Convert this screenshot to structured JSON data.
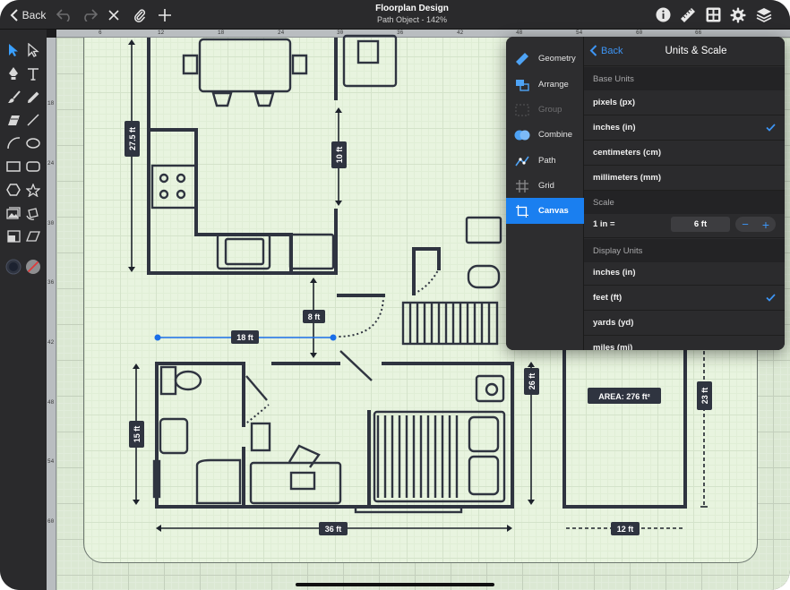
{
  "toolbar": {
    "back_label": "Back",
    "title": "Floorplan Design",
    "subtitle": "Path Object - 142%",
    "icons": [
      "undo-icon",
      "redo-icon",
      "close-icon",
      "paperclip-icon",
      "plus-icon",
      "info-icon",
      "ruler-icon",
      "grid-icon",
      "gear-icon",
      "layers-icon"
    ]
  },
  "tools": [
    "select-arrow",
    "direct-select",
    "pen",
    "text",
    "brush",
    "pencil",
    "eraser",
    "line",
    "arc",
    "ellipse",
    "rectangle",
    "rounded-rectangle",
    "hexagon",
    "star",
    "image",
    "rotate",
    "crop",
    "skew",
    "fill-color",
    "stroke-none"
  ],
  "ruler": {
    "top_labels": [
      "6",
      "12",
      "18",
      "24",
      "30",
      "36",
      "42",
      "48",
      "54",
      "60",
      "66"
    ],
    "left_labels": [
      "18",
      "24",
      "30",
      "36",
      "42",
      "48",
      "54",
      "60"
    ]
  },
  "dimensions": {
    "d1": "27.5 ft",
    "d2": "10 ft",
    "d3": "8 ft",
    "d4": "18 ft",
    "d5": "15 ft",
    "d6": "26 ft",
    "d7": "36 ft",
    "d8": "23 ft",
    "d9": "12 ft",
    "area": "AREA: 276 ft²"
  },
  "popover": {
    "menu": [
      {
        "label": "Geometry",
        "state": "normal"
      },
      {
        "label": "Arrange",
        "state": "normal"
      },
      {
        "label": "Group",
        "state": "disabled"
      },
      {
        "label": "Combine",
        "state": "normal"
      },
      {
        "label": "Path",
        "state": "normal"
      },
      {
        "label": "Grid",
        "state": "normal"
      },
      {
        "label": "Canvas",
        "state": "active"
      }
    ],
    "back_label": "Back",
    "title": "Units & Scale",
    "base_units_header": "Base Units",
    "base_units": [
      {
        "label": "pixels (px)",
        "checked": false
      },
      {
        "label": "inches (in)",
        "checked": true
      },
      {
        "label": "centimeters (cm)",
        "checked": false
      },
      {
        "label": "millimeters (mm)",
        "checked": false
      }
    ],
    "scale_header": "Scale",
    "scale_label": "1 in =",
    "scale_value": "6 ft",
    "stepper_minus": "−",
    "stepper_plus": "+",
    "display_units_header": "Display Units",
    "display_units": [
      {
        "label": "inches (in)",
        "checked": false
      },
      {
        "label": "feet (ft)",
        "checked": true
      },
      {
        "label": "yards (yd)",
        "checked": false
      },
      {
        "label": "miles (mi)",
        "checked": false
      }
    ]
  },
  "colors": {
    "accent": "#1a7ff0",
    "wall": "#2f3440",
    "dimension_label_bg": "#2f3440",
    "selection_handle": "#1a6ee8",
    "canvas_grid": "#dbe8d3"
  }
}
